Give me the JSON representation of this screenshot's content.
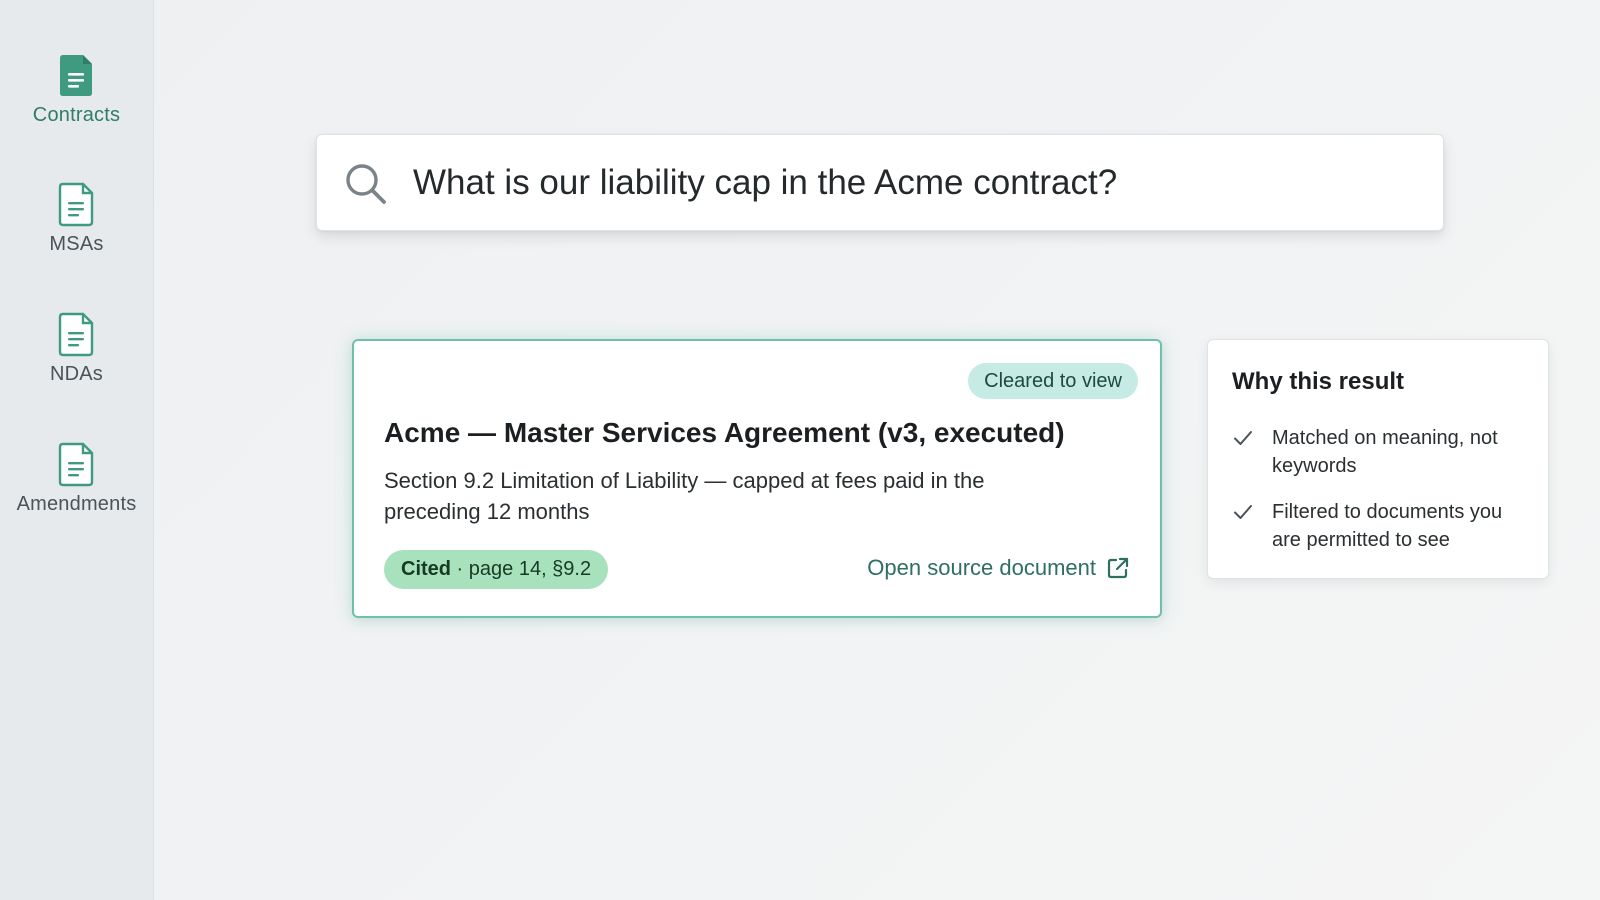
{
  "sidebar": {
    "items": [
      {
        "label": "Contracts",
        "icon": "document-filled-icon",
        "active": true
      },
      {
        "label": "MSAs",
        "icon": "document-icon",
        "active": false
      },
      {
        "label": "NDAs",
        "icon": "document-icon",
        "active": false
      },
      {
        "label": "Amendments",
        "icon": "document-icon",
        "active": false
      }
    ]
  },
  "search": {
    "icon": "search-icon",
    "value": "What is our liability cap in the Acme contract?"
  },
  "result": {
    "badge": "Cleared to view",
    "title": "Acme — Master Services Agreement (v3, executed)",
    "snippet": "Section 9.2 Limitation of Liability — capped at fees paid in the preceding 12 months",
    "citation": {
      "strong": "Cited",
      "detail": " · page 14, §9.2"
    },
    "open_link": "Open source document",
    "open_link_icon": "external-link-icon"
  },
  "why": {
    "title": "Why this result",
    "reasons": [
      "Matched on meaning, not keywords",
      "Filtered to documents you are permitted to see"
    ],
    "reason_icon": "check-icon"
  },
  "colors": {
    "accent": "#2f7d68",
    "card_border": "#6fc0aa",
    "cleared_badge_bg": "#c6eae4",
    "cited_badge_bg": "#a8e2bd",
    "link": "#2f6f61"
  }
}
